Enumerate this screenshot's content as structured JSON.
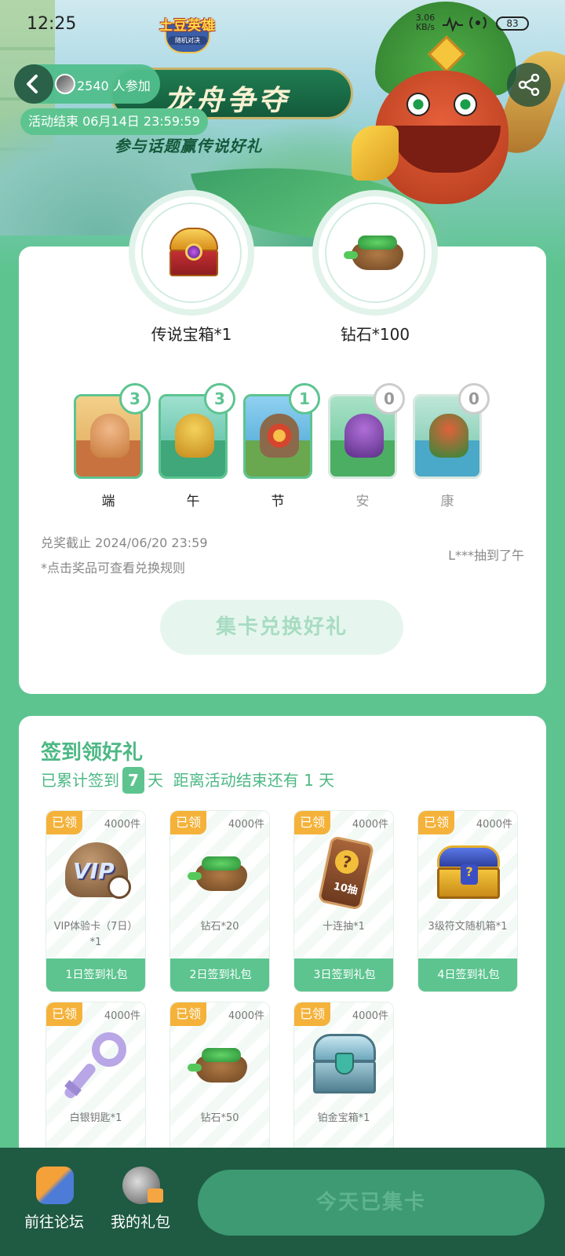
{
  "status_bar": {
    "time": "12:25",
    "network_speed": "3.06",
    "network_unit": "KB/s",
    "battery": "83"
  },
  "header": {
    "game_logo": "土豆英雄",
    "game_logo_sub": "随机对决",
    "banner_title": "龙舟争夺",
    "banner_subtitle": "参与话题赢传说好礼",
    "participants": "2540 人参加",
    "end_time": "活动结束 06月14日 23:59:59"
  },
  "rewards": [
    {
      "label": "传说宝箱*1",
      "icon": "legendary-chest-icon"
    },
    {
      "label": "钻石*100",
      "icon": "diamond-bag-icon"
    }
  ],
  "cards": [
    {
      "name": "端",
      "count": "3",
      "collected": true
    },
    {
      "name": "午",
      "count": "3",
      "collected": true
    },
    {
      "name": "节",
      "count": "1",
      "collected": true
    },
    {
      "name": "安",
      "count": "0",
      "collected": false
    },
    {
      "name": "康",
      "count": "0",
      "collected": false
    }
  ],
  "redeem": {
    "deadline": "兑奖截止 2024/06/20 23:59",
    "rule_hint": "*点击奖品可查看兑换规则",
    "winner_note": "L***抽到了午",
    "exchange_button": "集卡兑换好礼"
  },
  "checkin": {
    "title": "签到领好礼",
    "summary_prefix": "已累计签到",
    "days": "7",
    "summary_suffix": "天",
    "remaining": "距离活动结束还有 1 天",
    "gifts": [
      {
        "tag": "已领",
        "stock": "4000件",
        "desc": "VIP体验卡（7日）*1",
        "footer": "1日签到礼包",
        "icon": "vip-card-icon"
      },
      {
        "tag": "已领",
        "stock": "4000件",
        "desc": "钻石*20",
        "footer": "2日签到礼包",
        "icon": "diamond-bag-icon"
      },
      {
        "tag": "已领",
        "stock": "4000件",
        "desc": "十连抽*1",
        "footer": "3日签到礼包",
        "icon": "ten-draw-ticket-icon"
      },
      {
        "tag": "已领",
        "stock": "4000件",
        "desc": "3级符文随机箱*1",
        "footer": "4日签到礼包",
        "icon": "rune-chest-icon"
      },
      {
        "tag": "已领",
        "stock": "4000件",
        "desc": "白银钥匙*1",
        "icon": "silver-key-icon"
      },
      {
        "tag": "已领",
        "stock": "4000件",
        "desc": "钻石*50",
        "icon": "diamond-bag-icon"
      },
      {
        "tag": "已领",
        "stock": "4000件",
        "desc": "铂金宝箱*1",
        "icon": "platinum-chest-icon"
      }
    ]
  },
  "bottom_bar": {
    "forum_label": "前往论坛",
    "gifts_label": "我的礼包",
    "today_button": "今天已集卡"
  },
  "colors": {
    "accent": "#5dc490",
    "tag": "#f5b23a",
    "bottom_bar": "#1f5a43"
  }
}
